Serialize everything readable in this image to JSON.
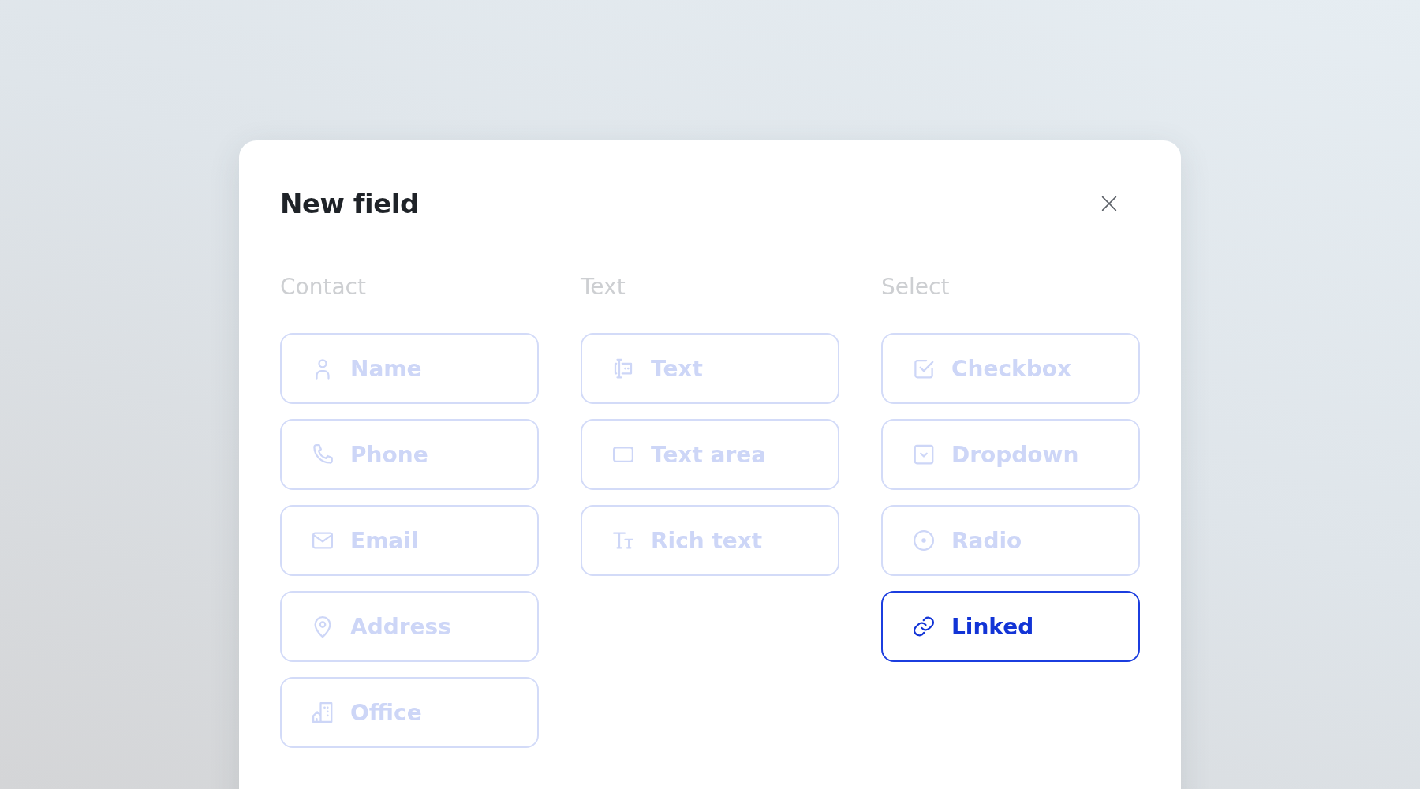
{
  "dialog": {
    "title": "New field"
  },
  "groups": [
    {
      "heading": "Contact",
      "options": [
        {
          "label": "Name",
          "kind": "name",
          "selected": false
        },
        {
          "label": "Phone",
          "kind": "phone",
          "selected": false
        },
        {
          "label": "Email",
          "kind": "email",
          "selected": false
        },
        {
          "label": "Address",
          "kind": "address",
          "selected": false
        },
        {
          "label": "Office",
          "kind": "office",
          "selected": false
        }
      ]
    },
    {
      "heading": "Text",
      "options": [
        {
          "label": "Text",
          "kind": "text",
          "selected": false
        },
        {
          "label": "Text area",
          "kind": "textarea",
          "selected": false
        },
        {
          "label": "Rich text",
          "kind": "richtext",
          "selected": false
        }
      ]
    },
    {
      "heading": "Select",
      "options": [
        {
          "label": "Checkbox",
          "kind": "checkbox",
          "selected": false
        },
        {
          "label": "Dropdown",
          "kind": "dropdown",
          "selected": false
        },
        {
          "label": "Radio",
          "kind": "radio",
          "selected": false
        },
        {
          "label": "Linked",
          "kind": "linked",
          "selected": true
        }
      ]
    }
  ]
}
